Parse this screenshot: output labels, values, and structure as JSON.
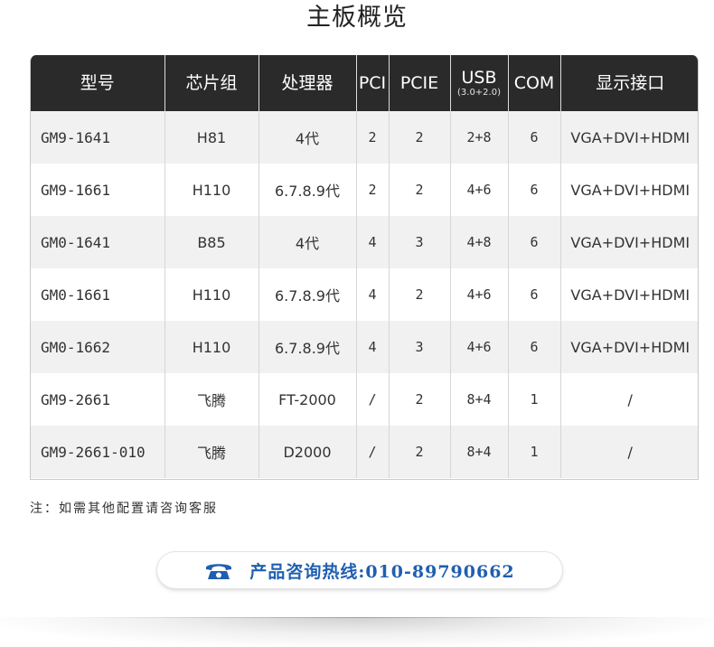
{
  "title": "主板概览",
  "table": {
    "headers": [
      {
        "label": "型号",
        "sub": ""
      },
      {
        "label": "芯片组",
        "sub": ""
      },
      {
        "label": "处理器",
        "sub": ""
      },
      {
        "label": "PCI",
        "sub": ""
      },
      {
        "label": "PCIE",
        "sub": ""
      },
      {
        "label": "USB",
        "sub": "(3.0+2.0)"
      },
      {
        "label": "COM",
        "sub": ""
      },
      {
        "label": "显示接口",
        "sub": ""
      }
    ],
    "rows": [
      [
        "GM9-1641",
        "H81",
        "4代",
        "2",
        "2",
        "2+8",
        "6",
        "VGA+DVI+HDMI"
      ],
      [
        "GM9-1661",
        "H110",
        "6.7.8.9代",
        "2",
        "2",
        "4+6",
        "6",
        "VGA+DVI+HDMI"
      ],
      [
        "GM0-1641",
        "B85",
        "4代",
        "4",
        "3",
        "4+8",
        "6",
        "VGA+DVI+HDMI"
      ],
      [
        "GM0-1661",
        "H110",
        "6.7.8.9代",
        "4",
        "2",
        "4+6",
        "6",
        "VGA+DVI+HDMI"
      ],
      [
        "GM0-1662",
        "H110",
        "6.7.8.9代",
        "4",
        "3",
        "4+6",
        "6",
        "VGA+DVI+HDMI"
      ],
      [
        "GM9-2661",
        "飞腾",
        "FT-2000",
        "/",
        "2",
        "8+4",
        "1",
        "/"
      ],
      [
        "GM9-2661-010",
        "飞腾",
        "D2000",
        "/",
        "2",
        "8+4",
        "1",
        "/"
      ]
    ]
  },
  "note": "注：如需其他配置请咨询客服",
  "hotline": {
    "icon": "telephone-icon",
    "text": "产品咨询热线:010-89790662",
    "color": "#1f5fb0"
  },
  "colors": {
    "header_bg": "#2a2a2a",
    "row_alt_bg": "#f1f1f1"
  }
}
